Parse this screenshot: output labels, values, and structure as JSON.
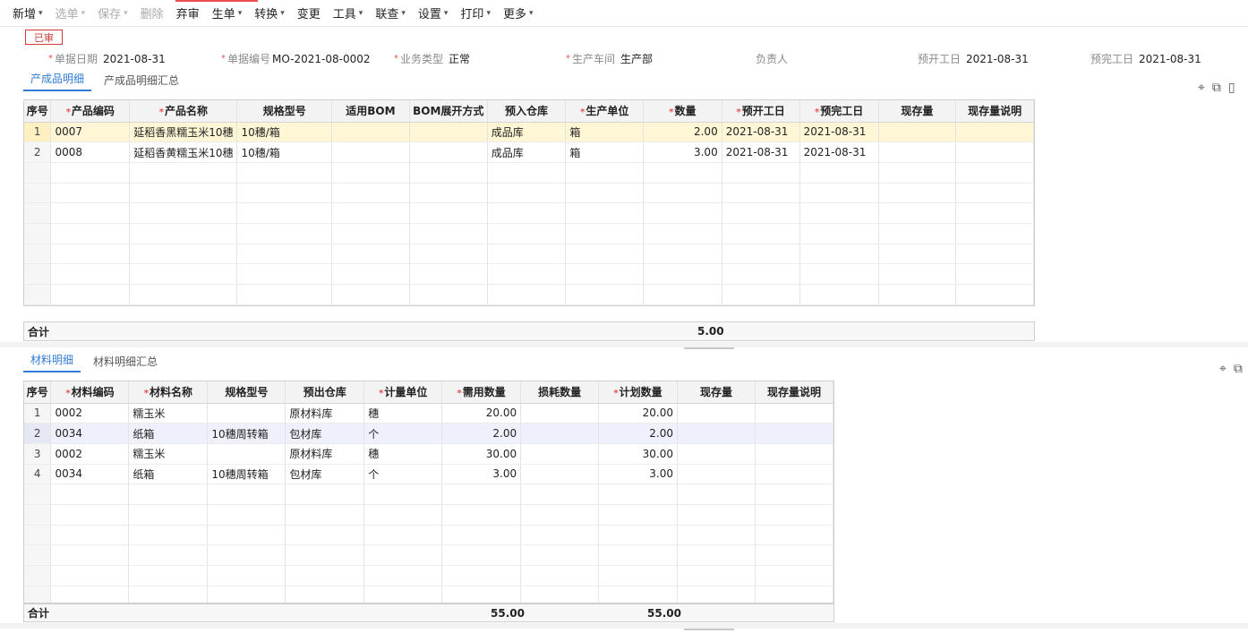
{
  "toolbar": {
    "items": [
      {
        "label": "新增",
        "dropdown": true,
        "disabled": false
      },
      {
        "label": "选单",
        "dropdown": true,
        "disabled": true
      },
      {
        "label": "保存",
        "dropdown": true,
        "disabled": true
      },
      {
        "label": "删除",
        "dropdown": false,
        "disabled": true
      },
      {
        "label": "弃审",
        "dropdown": false,
        "disabled": false
      },
      {
        "label": "生单",
        "dropdown": true,
        "disabled": false
      },
      {
        "label": "转换",
        "dropdown": true,
        "disabled": false
      },
      {
        "label": "变更",
        "dropdown": false,
        "disabled": false
      },
      {
        "label": "工具",
        "dropdown": true,
        "disabled": false
      },
      {
        "label": "联查",
        "dropdown": true,
        "disabled": false
      },
      {
        "label": "设置",
        "dropdown": true,
        "disabled": false
      },
      {
        "label": "打印",
        "dropdown": true,
        "disabled": false
      },
      {
        "label": "更多",
        "dropdown": true,
        "disabled": false
      }
    ]
  },
  "status": {
    "label": "已审",
    "color": "#d23b3b"
  },
  "header": {
    "doc_date": {
      "label": "单据日期",
      "value": "2021-08-31"
    },
    "doc_no": {
      "label": "单据编号",
      "value": "MO-2021-08-0002"
    },
    "biz_type": {
      "label": "业务类型",
      "value": "正常"
    },
    "workshop": {
      "label": "生产车间",
      "value": "生产部"
    },
    "owner": {
      "label": "负责人",
      "value": ""
    },
    "plan_start": {
      "label": "预开工日",
      "value": "2021-08-31"
    },
    "plan_end": {
      "label": "预完工日",
      "value": "2021-08-31"
    }
  },
  "product_tabs": {
    "detail": "产成品明细",
    "summary": "产成品明细汇总"
  },
  "product_grid": {
    "columns": [
      "序号",
      "产品编码",
      "产品名称",
      "规格型号",
      "适用BOM",
      "BOM展开方式",
      "预入仓库",
      "生产单位",
      "数量",
      "预开工日",
      "预完工日",
      "现存量",
      "现存量说明"
    ],
    "rows": [
      [
        "1",
        "0007",
        "延稻香黑糯玉米10穗",
        "10穗/箱",
        "",
        "",
        "成品库",
        "箱",
        "2.00",
        "2021-08-31",
        "2021-08-31",
        "",
        ""
      ],
      [
        "2",
        "0008",
        "延稻香黄糯玉米10穗",
        "10穗/箱",
        "",
        "",
        "成品库",
        "箱",
        "3.00",
        "2021-08-31",
        "2021-08-31",
        "",
        ""
      ]
    ],
    "empty_rows": 7,
    "total_label": "合计",
    "total_qty": "5.00"
  },
  "material_tabs": {
    "detail": "材料明细",
    "summary": "材料明细汇总"
  },
  "material_grid": {
    "columns": [
      "序号",
      "材料编码",
      "材料名称",
      "规格型号",
      "预出仓库",
      "计量单位",
      "需用数量",
      "损耗数量",
      "计划数量",
      "现存量",
      "现存量说明"
    ],
    "rows": [
      [
        "1",
        "0002",
        "糯玉米",
        "",
        "原材料库",
        "穗",
        "20.00",
        "",
        "20.00",
        "",
        ""
      ],
      [
        "2",
        "0034",
        "纸箱",
        "10穗周转箱",
        "包材库",
        "个",
        "2.00",
        "",
        "2.00",
        "",
        ""
      ],
      [
        "3",
        "0002",
        "糯玉米",
        "",
        "原材料库",
        "穗",
        "30.00",
        "",
        "30.00",
        "",
        ""
      ],
      [
        "4",
        "0034",
        "纸箱",
        "10穗周转箱",
        "包材库",
        "个",
        "3.00",
        "",
        "3.00",
        "",
        ""
      ]
    ],
    "empty_rows": 6,
    "total_label": "合计",
    "total_need": "55.00",
    "total_plan": "55.00"
  },
  "icons": {
    "location": "location-pin-icon",
    "copy": "copy-icon",
    "delete": "trash-icon"
  }
}
